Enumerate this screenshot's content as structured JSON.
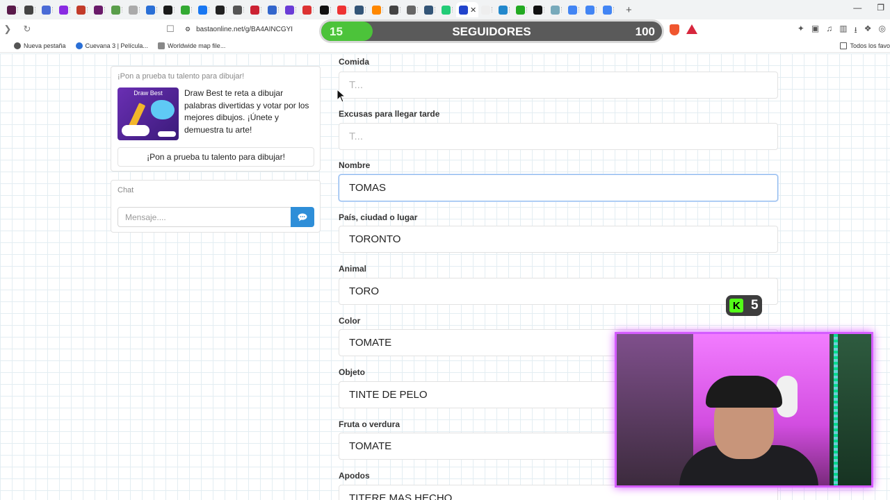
{
  "browser": {
    "tab_count_left": 35,
    "url": "bastaonline.net/g/BA4AINCGYI",
    "bookmarks": [
      {
        "label": "Nueva pestaña",
        "icon": "globe-icon"
      },
      {
        "label": "Cuevana 3 | Película...",
        "icon": "cuevana-icon"
      },
      {
        "label": "Worldwide map file...",
        "icon": "map-icon"
      }
    ],
    "bookmarks_right": "Todos los favo"
  },
  "followers": {
    "current": "15",
    "title": "SEGUIDORES",
    "goal": "100",
    "progress_fraction": 0.15,
    "fill_color": "#4cc33a"
  },
  "promo": {
    "heading": "¡Pon a prueba tu talento para dibujar!",
    "thumb_title": "Draw Best",
    "description": "Draw Best te reta a dibujar palabras divertidas y votar por los mejores dibujos. ¡Únete y demuestra tu arte!",
    "button_label": "¡Pon a prueba tu talento para dibujar!"
  },
  "chat": {
    "title": "Chat",
    "placeholder": "Mensaje....",
    "send_icon": "chat-bubble-icon",
    "accent": "#2e8ed8"
  },
  "fields": [
    {
      "label": "Comida",
      "value": "",
      "placeholder": "T..."
    },
    {
      "label": "Excusas para llegar tarde",
      "value": "",
      "placeholder": "T..."
    },
    {
      "label": "Nombre",
      "value": "TOMAS",
      "placeholder": ""
    },
    {
      "label": "País, ciudad o lugar",
      "value": "TORONTO",
      "placeholder": ""
    },
    {
      "label": "Animal",
      "value": "TORO",
      "placeholder": ""
    },
    {
      "label": "Color",
      "value": "TOMATE",
      "placeholder": ""
    },
    {
      "label": "Objeto",
      "value": "TINTE DE PELO",
      "placeholder": ""
    },
    {
      "label": "Fruta o verdura",
      "value": "TOMATE",
      "placeholder": ""
    },
    {
      "label": "Apodos",
      "value": "TITERE MAS HECHO",
      "placeholder": ""
    }
  ],
  "kick_badge": {
    "count": "5",
    "color": "#53fc18"
  }
}
